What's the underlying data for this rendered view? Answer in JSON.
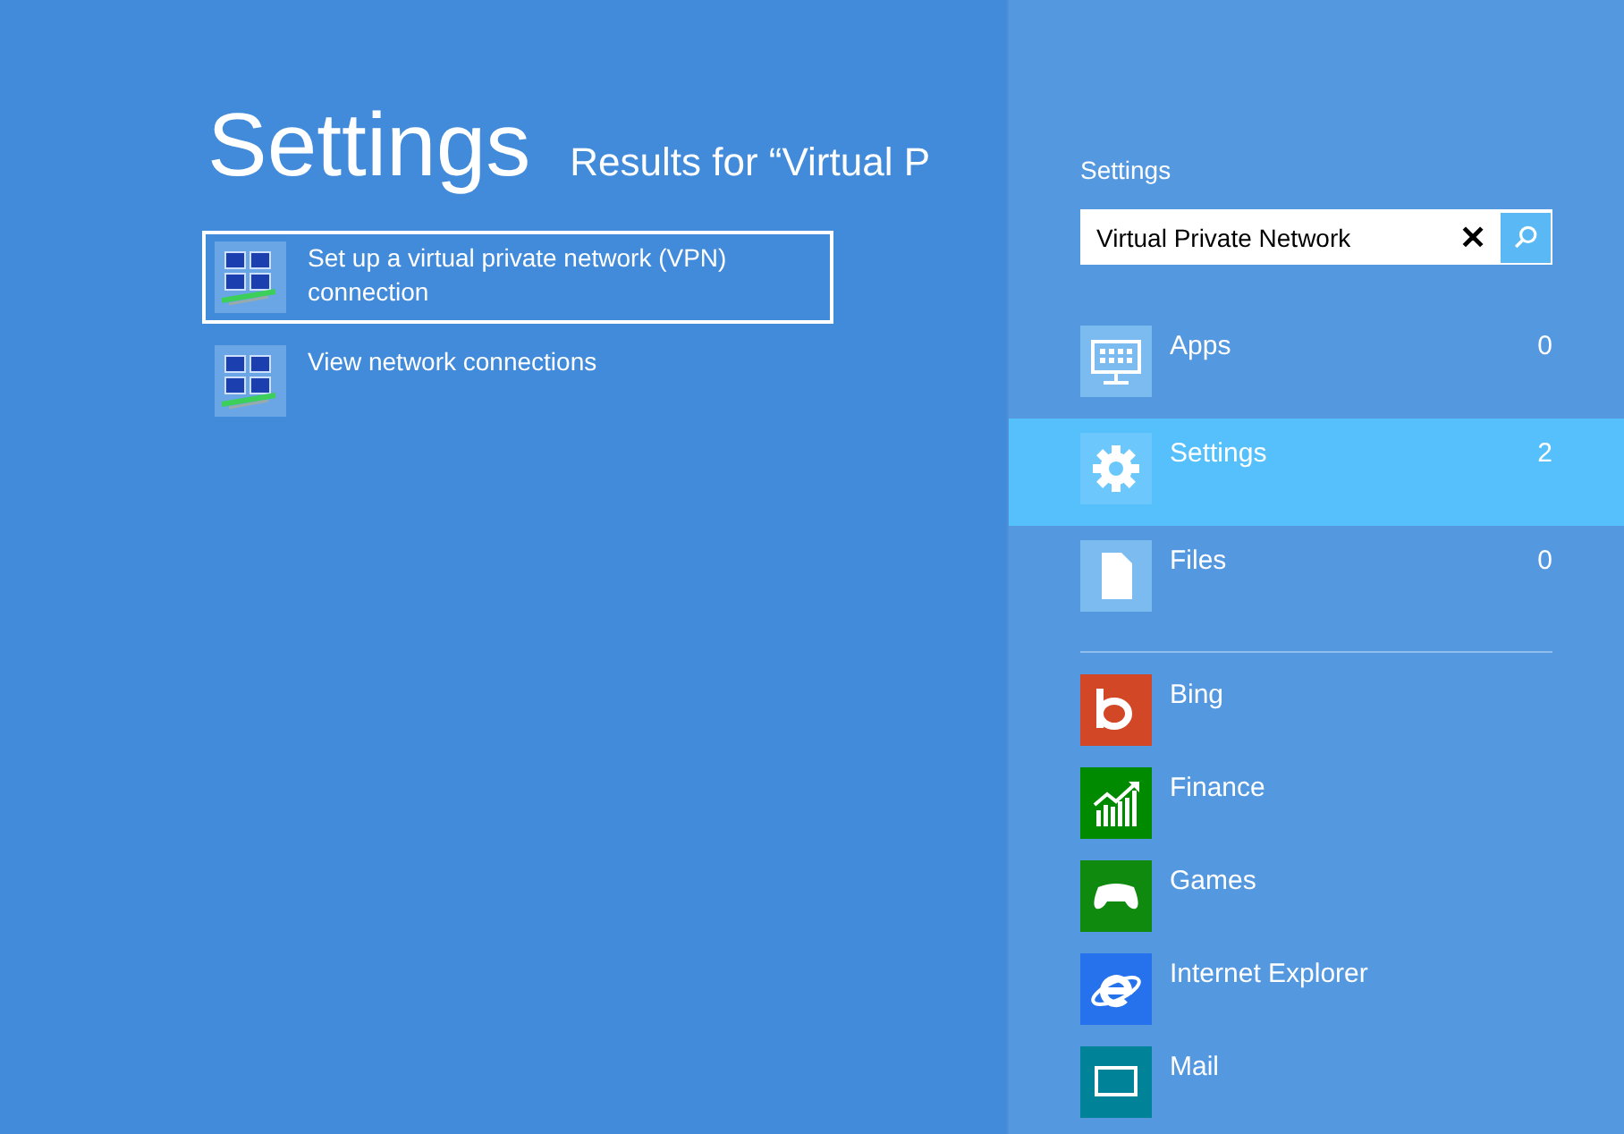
{
  "heading": "Settings",
  "results_title": "Results for “Virtual P",
  "results": [
    {
      "label": "Set up a virtual private network (VPN) connection",
      "selected": true
    },
    {
      "label": "View network connections",
      "selected": false
    }
  ],
  "search_pane": {
    "title": "Settings",
    "search": {
      "value": "Virtual Private Network",
      "clear": "✕"
    },
    "categories": [
      {
        "kind": "apps",
        "label": "Apps",
        "count": "0",
        "selected": false
      },
      {
        "kind": "settings",
        "label": "Settings",
        "count": "2",
        "selected": true
      },
      {
        "kind": "files",
        "label": "Files",
        "count": "0",
        "selected": false
      }
    ],
    "apps": [
      {
        "kind": "bing",
        "label": "Bing",
        "color": "#d24726"
      },
      {
        "kind": "finance",
        "label": "Finance",
        "color": "#008a00"
      },
      {
        "kind": "games",
        "label": "Games",
        "color": "#0f8a0f"
      },
      {
        "kind": "ie",
        "label": "Internet Explorer",
        "color": "#2672ec"
      },
      {
        "kind": "mail",
        "label": "Mail",
        "color": "#008299"
      }
    ]
  }
}
